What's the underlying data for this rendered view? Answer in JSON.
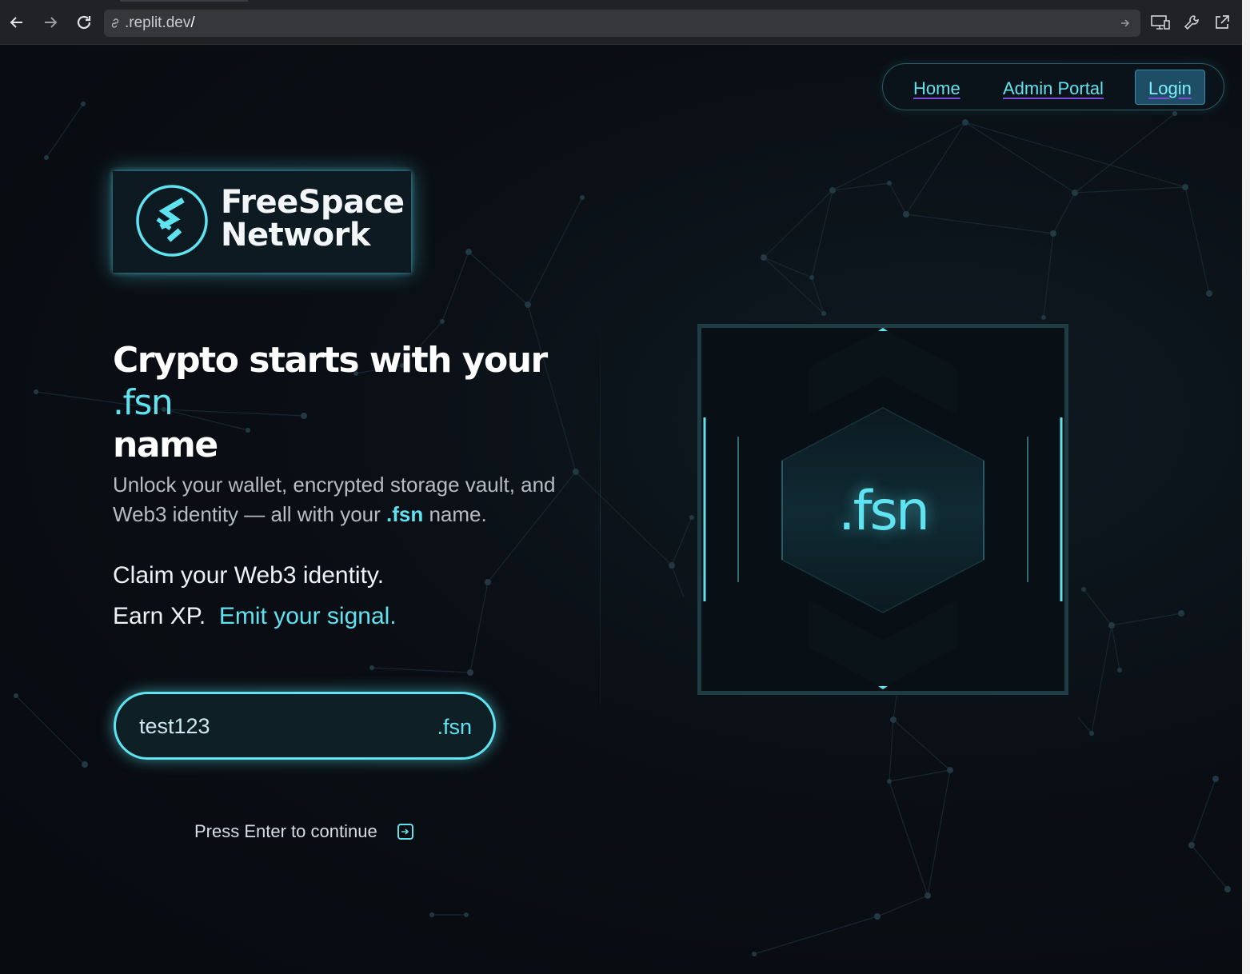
{
  "browser": {
    "url_prefix": ".replit.dev",
    "url_suffix": "/"
  },
  "nav": {
    "home": "Home",
    "admin": "Admin Portal",
    "login": "Login"
  },
  "logo": {
    "line1": "FreeSpace",
    "line2": "Network"
  },
  "hero": {
    "headline_main": "Crypto starts with your ",
    "headline_accent": ".fsn",
    "headline_end": "name",
    "sub_part1": "Unlock your wallet, encrypted storage vault, and Web3 identity — all with your ",
    "sub_fsn": ".fsn",
    "sub_part2": " name.",
    "claim_line1": "Claim your Web3 identity.",
    "claim_line2_a": "Earn XP.",
    "claim_line2_b": "Emit your signal."
  },
  "name_input": {
    "value": "test123",
    "suffix": ".fsn"
  },
  "hint": {
    "text": "Press Enter to continue",
    "icon": "enter-icon"
  },
  "visual": {
    "label": ".fsn"
  },
  "colors": {
    "accent": "#5fe3f0",
    "background": "#0a0d12",
    "underline": "#7a4dd8"
  }
}
